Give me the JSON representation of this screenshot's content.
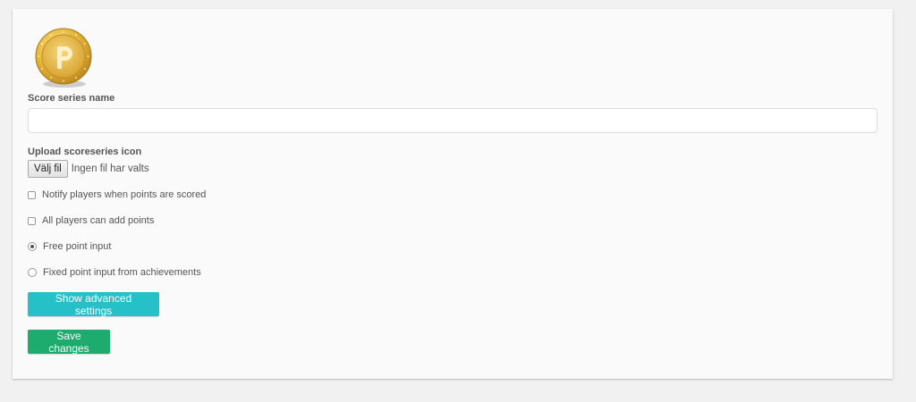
{
  "form": {
    "name_label": "Score series name",
    "name_value": "",
    "icon_label": "Upload scoreseries icon",
    "file_button": "Välj fil",
    "file_status": "Ingen fil har valts",
    "options": {
      "notify": {
        "label": "Notify players when points are scored",
        "checked": false
      },
      "all_players": {
        "label": "All players can add points",
        "checked": false
      },
      "free_input": {
        "label": "Free point input",
        "selected": true
      },
      "fixed_input": {
        "label": "Fixed point input from achievements",
        "selected": false
      }
    },
    "advanced_button": "Show advanced settings",
    "save_button": "Save changes"
  },
  "icons": {
    "score_icon": "gold-coin-icon"
  },
  "colors": {
    "advanced_button": "#26c0c8",
    "save_button": "#1eab6e",
    "coin_gold": "#e7b83a"
  }
}
